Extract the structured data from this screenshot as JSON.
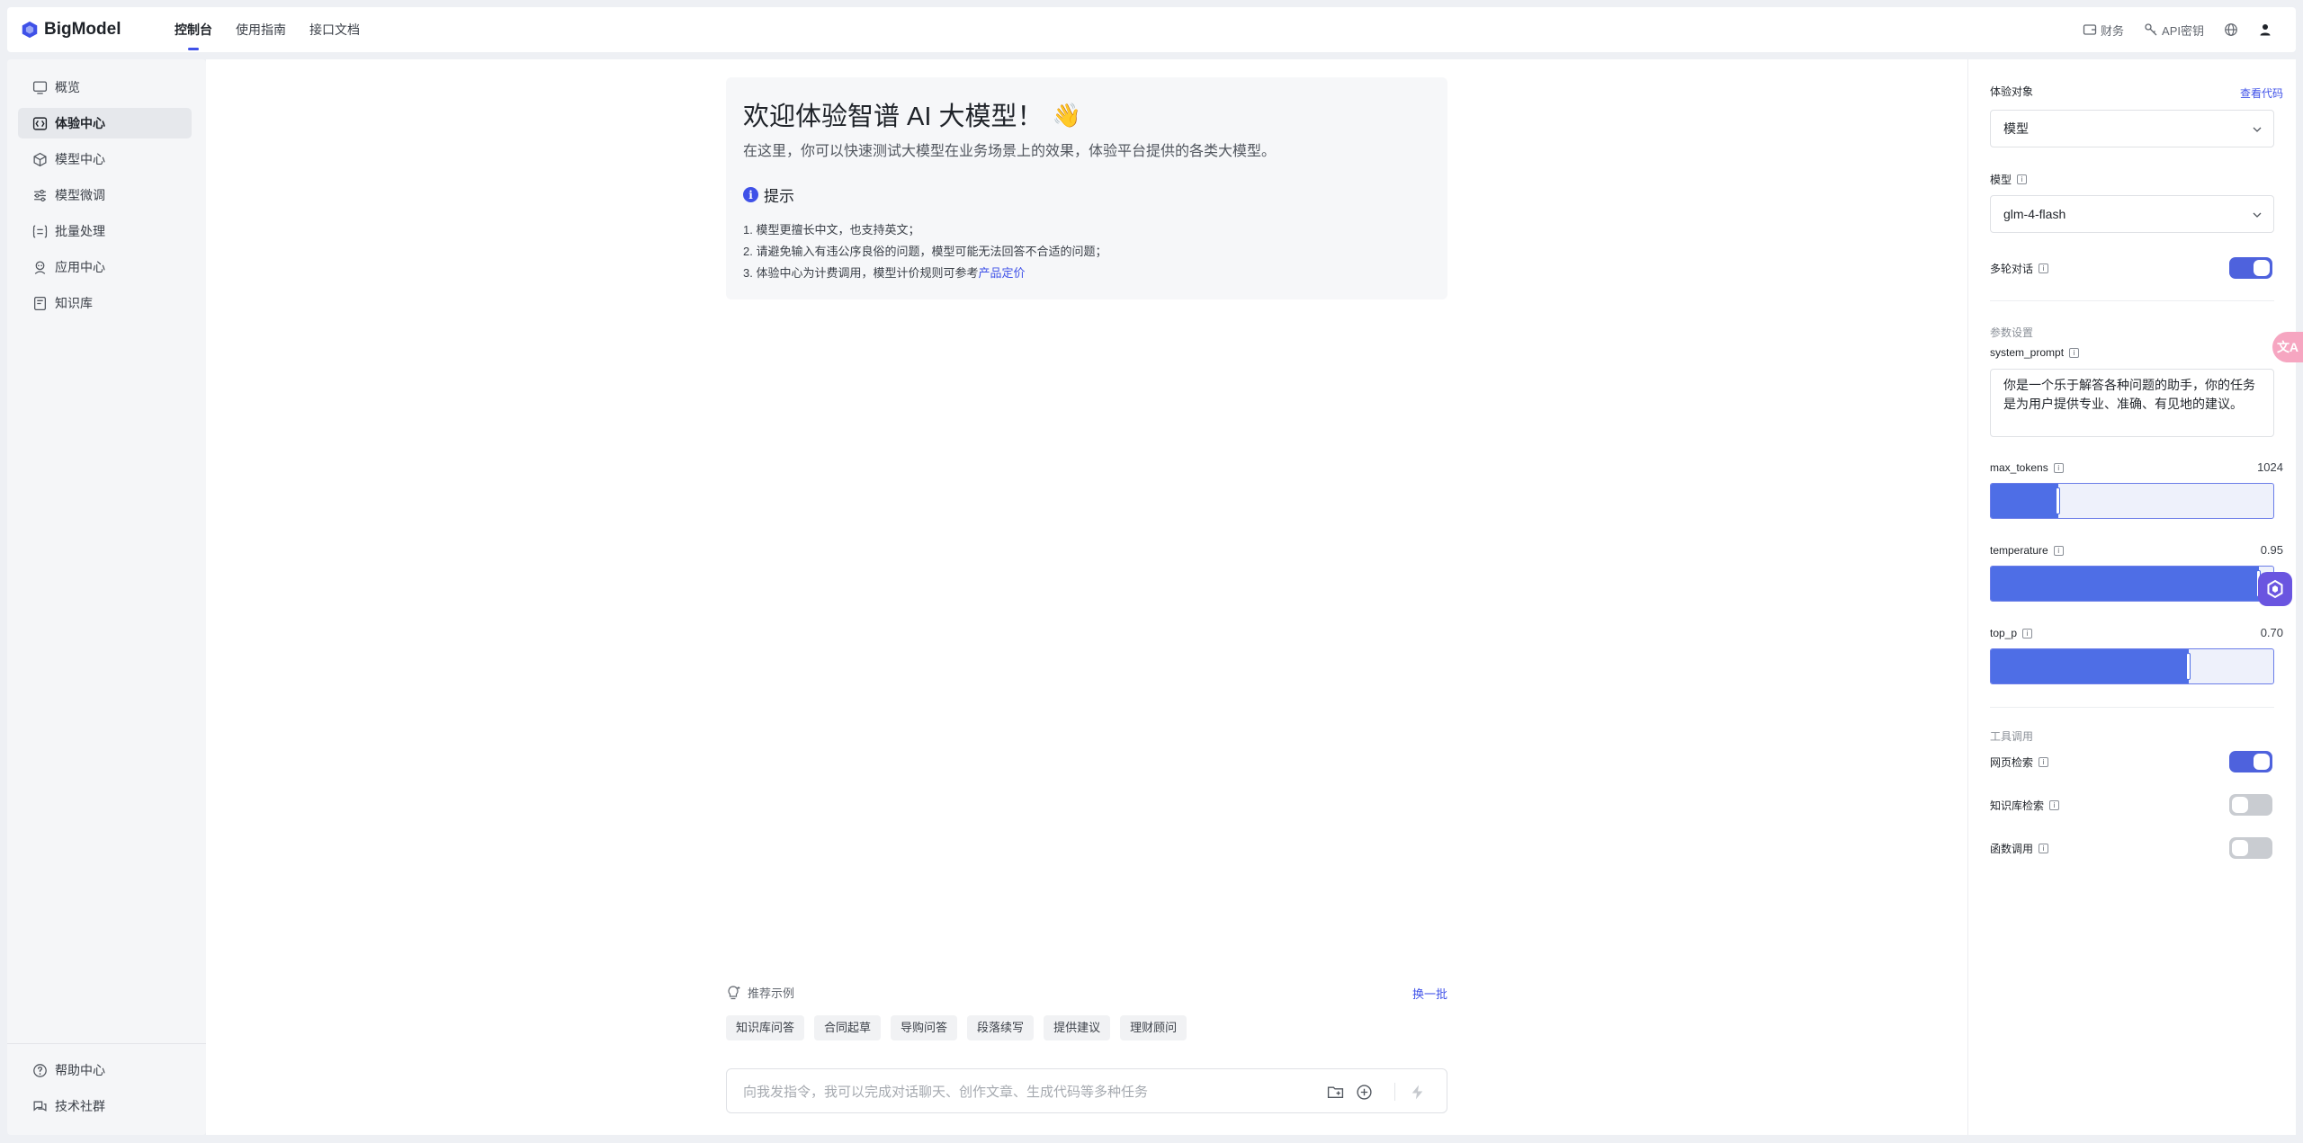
{
  "topnav": {
    "logo_text": "BigModel",
    "items": [
      "控制台",
      "使用指南",
      "接口文档"
    ],
    "right": {
      "finance": "财务",
      "api_key": "API密钥"
    }
  },
  "sidebar": {
    "items": [
      "概览",
      "体验中心",
      "模型中心",
      "模型微调",
      "批量处理",
      "应用中心",
      "知识库"
    ],
    "bottom": [
      "帮助中心",
      "技术社群"
    ]
  },
  "welcome": {
    "title": "欢迎体验智谱 AI 大模型！",
    "subtitle": "在这里，你可以快速测试大模型在业务场景上的效果，体验平台提供的各类大模型。",
    "tip_title": "提示",
    "tips": [
      "1. 模型更擅长中文，也支持英文；",
      "2. 请避免输入有违公序良俗的问题，模型可能无法回答不合适的问题；"
    ],
    "tip3_prefix": "3. 体验中心为计费调用，模型计价规则可参考",
    "tip3_link": "产品定价"
  },
  "recommend": {
    "label": "推荐示例",
    "refresh": "换一批",
    "chips": [
      "知识库问答",
      "合同起草",
      "导购问答",
      "段落续写",
      "提供建议",
      "理财顾问"
    ]
  },
  "chat": {
    "placeholder": "向我发指令，我可以完成对话聊天、创作文章、生成代码等多种任务"
  },
  "panel": {
    "target_label": "体验对象",
    "view_code": "查看代码",
    "target_value": "模型",
    "model_label": "模型",
    "model_value": "glm-4-flash",
    "multi_turn_label": "多轮对话",
    "multi_turn_on": true,
    "params_section": "参数设置",
    "system_prompt_label": "system_prompt",
    "system_prompt_value": "你是一个乐于解答各种问题的助手，你的任务是为用户提供专业、准确、有见地的建议。",
    "max_tokens_label": "max_tokens",
    "max_tokens_value": "1024",
    "max_tokens_fraction": 0.24,
    "temperature_label": "temperature",
    "temperature_value": "0.95",
    "temperature_fraction": 0.95,
    "top_p_label": "top_p",
    "top_p_value": "0.70",
    "top_p_fraction": 0.7,
    "tools_section": "工具调用",
    "web_search_label": "网页检索",
    "web_search_on": true,
    "kb_search_label": "知识库检索",
    "kb_search_on": false,
    "func_call_label": "函数调用",
    "func_call_on": false
  },
  "floating": {
    "translate_glyph": "文A"
  },
  "colors": {
    "accent": "#3f51e8",
    "slider_fill": "#4e6ee6",
    "toggle_on": "#4e62dd",
    "toggle_off": "#c9ccd1"
  }
}
